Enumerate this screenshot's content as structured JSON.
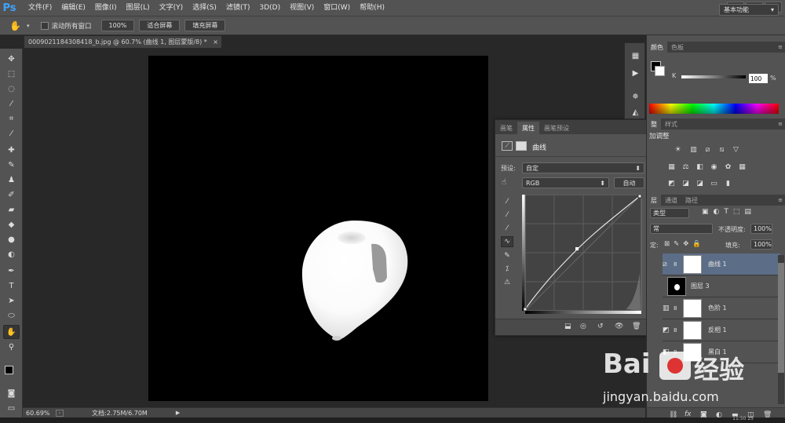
{
  "app": {
    "logo": "Ps"
  },
  "menu": [
    "文件(F)",
    "编辑(E)",
    "图像(I)",
    "图层(L)",
    "文字(Y)",
    "选择(S)",
    "滤镜(T)",
    "3D(D)",
    "视图(V)",
    "窗口(W)",
    "帮助(H)"
  ],
  "window_controls": [
    "—",
    "❐",
    "✕"
  ],
  "options_bar": {
    "scroll_all_label": "滚动所有窗口",
    "zoom_btn": "100%",
    "fit_screen_btn": "适合屏幕",
    "fill_screen_btn": "填充屏幕",
    "workspace": "基本功能"
  },
  "document": {
    "tab_title": "0009021184308418_b.jpg @ 60.7% (曲线 1, 图层蒙版/8) *",
    "close": "×"
  },
  "status": {
    "zoom": "60.69%",
    "doc_info": "文档:2.75M/6.70M"
  },
  "properties": {
    "tabs": [
      "画笔",
      "属性",
      "画笔预设"
    ],
    "active_tab": 1,
    "title": "曲线",
    "preset_label": "预设:",
    "preset_value": "自定",
    "channel_value": "RGB",
    "auto_btn": "自动"
  },
  "color_panel": {
    "tabs": [
      "颜色",
      "色板"
    ],
    "k_label": "K",
    "k_value": "100",
    "k_percent": "%"
  },
  "adjust_panel": {
    "tabs": [
      "整",
      "样式"
    ],
    "title": "加调整"
  },
  "layers_panel": {
    "tabs": [
      "层",
      "通道",
      "路径"
    ],
    "kind_label": "类型",
    "blend_mode": "常",
    "opacity_label": "不透明度:",
    "opacity_value": "100%",
    "lock_label": "定:",
    "fill_label": "填充:",
    "fill_value": "100%",
    "layers": [
      {
        "name": "曲线 1",
        "selected": true
      },
      {
        "name": "图层 3",
        "selected": false
      },
      {
        "name": "色阶 1",
        "selected": false
      },
      {
        "name": "反相 1",
        "selected": false
      },
      {
        "name": "黑白 1",
        "selected": false
      }
    ]
  },
  "watermark": {
    "brand": "Bai",
    "brand2": "经验",
    "url": "jingyan.baidu.com"
  },
  "clock": "11:50 25"
}
